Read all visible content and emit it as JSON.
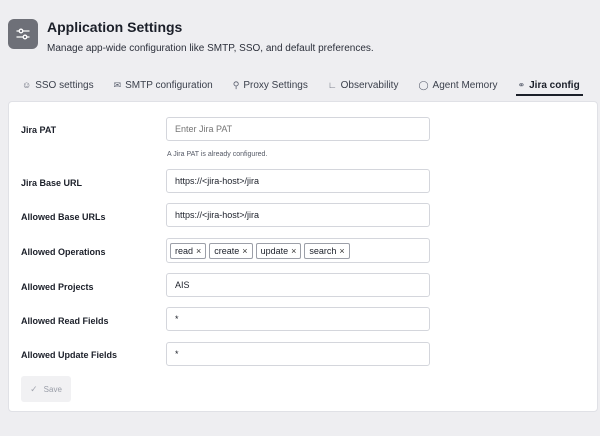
{
  "header": {
    "title": "Application Settings",
    "subtitle": "Manage app-wide configuration like SMTP, SSO, and default preferences."
  },
  "tabs": [
    {
      "label": "SSO settings",
      "icon": "users-icon",
      "active": false
    },
    {
      "label": "SMTP configuration",
      "icon": "mail-icon",
      "active": false
    },
    {
      "label": "Proxy Settings",
      "icon": "network-icon",
      "active": false
    },
    {
      "label": "Observability",
      "icon": "chart-icon",
      "active": false
    },
    {
      "label": "Agent Memory",
      "icon": "memory-icon",
      "active": false
    },
    {
      "label": "Jira config",
      "icon": "link-icon",
      "active": true
    }
  ],
  "form": {
    "jira_pat": {
      "label": "Jira PAT",
      "placeholder": "Enter Jira PAT",
      "value": "",
      "help": "A Jira PAT is already configured."
    },
    "jira_base_url": {
      "label": "Jira Base URL",
      "value": "https://<jira-host>/jira"
    },
    "allowed_base_urls": {
      "label": "Allowed Base URLs",
      "value": "https://<jira-host>/jira"
    },
    "allowed_operations": {
      "label": "Allowed Operations",
      "tags": [
        "read",
        "create",
        "update",
        "search"
      ]
    },
    "allowed_projects": {
      "label": "Allowed Projects",
      "value": "AIS"
    },
    "allowed_read_fields": {
      "label": "Allowed Read Fields",
      "value": "*"
    },
    "allowed_update_fields": {
      "label": "Allowed Update Fields",
      "value": "*"
    },
    "save_label": "Save"
  }
}
